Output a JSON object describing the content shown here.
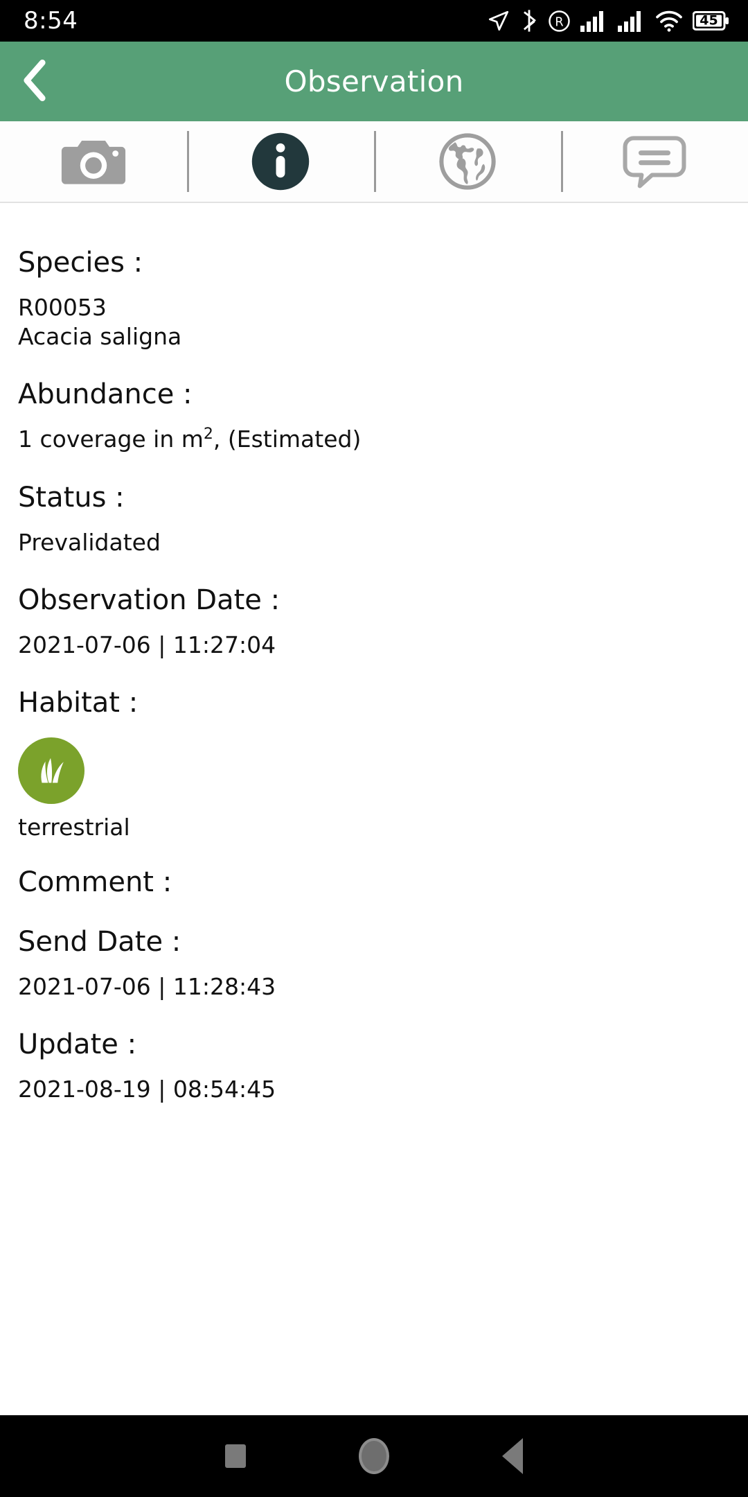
{
  "status_bar": {
    "time": "8:54",
    "battery_percent": "45",
    "icons": [
      "location-arrow-icon",
      "bluetooth-icon",
      "roaming-icon",
      "signal-bars-icon",
      "signal-bars-2-icon",
      "wifi-icon",
      "battery-icon"
    ]
  },
  "app_bar": {
    "title": "Observation",
    "back_icon": "chevron-left-icon",
    "background_color": "#57a077"
  },
  "tabs": [
    {
      "name": "photos",
      "icon": "camera-icon",
      "active": false,
      "color": "#9e9e9e"
    },
    {
      "name": "info",
      "icon": "info-circle-icon",
      "active": true,
      "color": "#22383c"
    },
    {
      "name": "map",
      "icon": "globe-icon",
      "active": false,
      "color": "#9e9e9e"
    },
    {
      "name": "comments",
      "icon": "comment-bubble-icon",
      "active": false,
      "color": "#9e9e9e"
    }
  ],
  "details": {
    "species": {
      "label": "Species :",
      "code": "R00053",
      "name": "Acacia saligna"
    },
    "abundance": {
      "label": "Abundance :",
      "value_prefix": "1 coverage in m",
      "value_sup": "2",
      "value_suffix": ", (Estimated)"
    },
    "status": {
      "label": "Status :",
      "value": "Prevalidated"
    },
    "observation_date": {
      "label": "Observation Date :",
      "value": "2021-07-06 | 11:27:04"
    },
    "habitat": {
      "label": "Habitat :",
      "icon": "grass-circle-icon",
      "icon_color": "#7ba22b",
      "value": "terrestrial"
    },
    "comment": {
      "label": "Comment :",
      "value": ""
    },
    "send_date": {
      "label": "Send Date :",
      "value": "2021-07-06 | 11:28:43"
    },
    "update": {
      "label": "Update :",
      "value": "2021-08-19 | 08:54:45"
    }
  },
  "nav_bar": {
    "recents": "square-icon",
    "home": "circle-icon",
    "back": "triangle-left-icon"
  }
}
